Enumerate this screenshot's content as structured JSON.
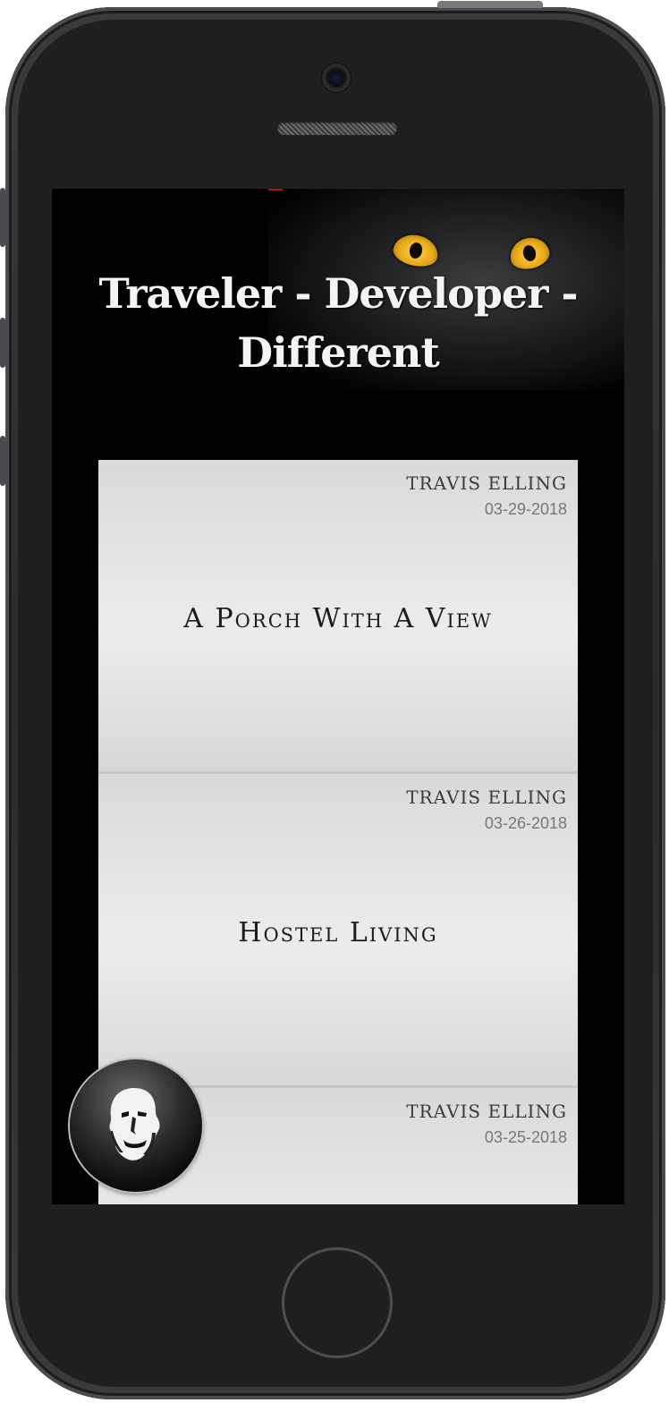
{
  "site": {
    "hero_title": "Traveler - Developer - Different"
  },
  "posts": [
    {
      "author": "TRAVIS ELLING",
      "date": "03-29-2018",
      "title": "A Porch With A View"
    },
    {
      "author": "TRAVIS ELLING",
      "date": "03-26-2018",
      "title": "Hostel Living"
    },
    {
      "author": "TRAVIS ELLING",
      "date": "03-25-2018",
      "title": ""
    }
  ],
  "icons": {
    "avatar": "face-avatar-icon",
    "camera": "camera-icon",
    "home": "home-button-icon"
  },
  "colors": {
    "screen_background": "#000000",
    "card_background": "#e4e4e4",
    "cat_eye": "#e6a718"
  }
}
